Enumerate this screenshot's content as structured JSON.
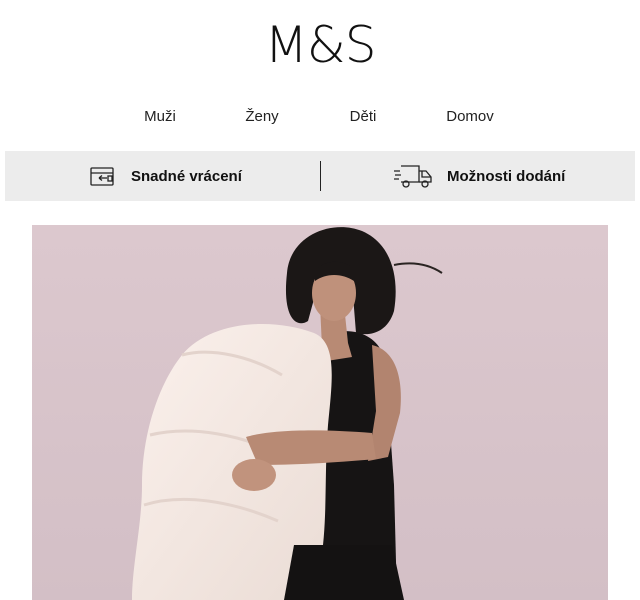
{
  "brand": {
    "logo_text": "M&S"
  },
  "nav": {
    "items": [
      {
        "label": "Muži"
      },
      {
        "label": "Ženy"
      },
      {
        "label": "Děti"
      },
      {
        "label": "Domov"
      }
    ]
  },
  "services": {
    "returns": {
      "label": "Snadné vrácení",
      "icon": "return-box-icon"
    },
    "delivery": {
      "label": "Možnosti dodání",
      "icon": "delivery-truck-icon"
    }
  },
  "hero": {
    "image": "woman-holding-duvet-photo",
    "background_color": "#d8c4ca"
  }
}
